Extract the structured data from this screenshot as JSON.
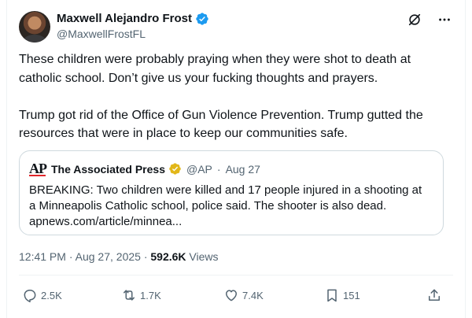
{
  "author": {
    "display_name": "Maxwell Alejandro Frost",
    "handle": "@MaxwellFrostFL",
    "verified": true
  },
  "top_actions": [
    {
      "name": "grok-icon"
    },
    {
      "name": "more-icon"
    }
  ],
  "post": {
    "text": "These children were probably praying when they were shot to death at catholic school. Don’t give us your fucking thoughts and prayers.\n\nTrump got rid of the Office of Gun Violence Prevention. Trump gutted the resources that were in place to keep our communities safe."
  },
  "quote": {
    "logo_text": "AP",
    "name": "The Associated Press",
    "verified": true,
    "handle": "@AP",
    "separator": "·",
    "date": "Aug 27",
    "text": "BREAKING: Two children were killed and 17 people injured in a shooting at a Minneapolis Catholic school, police said. The shooter is also dead.",
    "link": "apnews.com/article/minnea..."
  },
  "meta": {
    "time": "12:41 PM",
    "separator": "·",
    "date": "Aug 27, 2025",
    "views_count": "592.6K",
    "views_label": "Views"
  },
  "actions": {
    "replies": "2.5K",
    "reposts": "1.7K",
    "likes": "7.4K",
    "bookmarks": "151"
  },
  "colors": {
    "verified_blue": "#1d9bf0",
    "verified_gold": "#e2b719",
    "muted": "#536471",
    "text": "#0f1419",
    "ap_red": "#e0262a"
  }
}
